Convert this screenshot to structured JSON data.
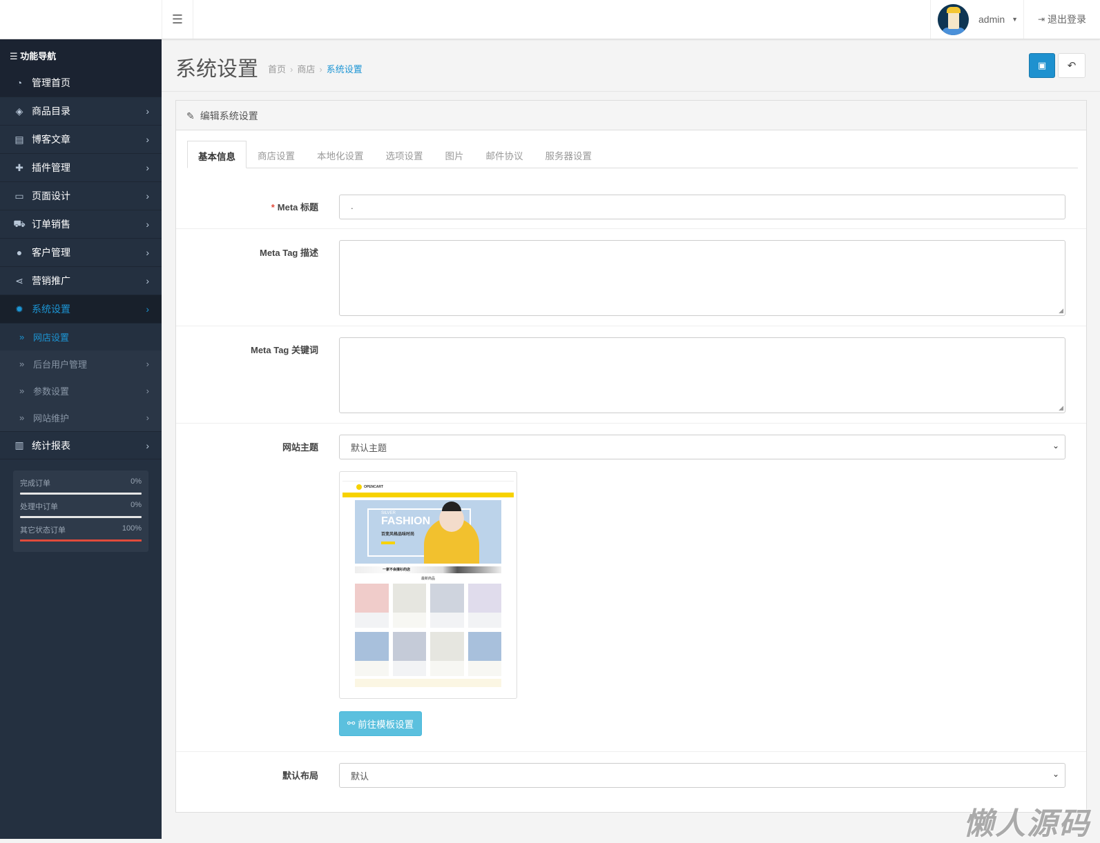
{
  "header": {
    "menu_icon": "bars-icon",
    "user": "admin",
    "logout": "退出登录"
  },
  "sidebar": {
    "title": "功能导航",
    "items": [
      {
        "label": "管理首页",
        "icon": "dashboard-icon"
      },
      {
        "label": "商品目录",
        "icon": "tags-icon"
      },
      {
        "label": "博客文章",
        "icon": "newspaper-icon"
      },
      {
        "label": "插件管理",
        "icon": "puzzle-icon"
      },
      {
        "label": "页面设计",
        "icon": "desktop-icon"
      },
      {
        "label": "订单销售",
        "icon": "cart-icon"
      },
      {
        "label": "客户管理",
        "icon": "user-icon"
      },
      {
        "label": "营销推广",
        "icon": "share-icon"
      },
      {
        "label": "系统设置",
        "icon": "gear-icon"
      }
    ],
    "subitems": [
      {
        "label": "网店设置"
      },
      {
        "label": "后台用户管理"
      },
      {
        "label": "参数设置"
      },
      {
        "label": "网站维护"
      }
    ],
    "reports": {
      "label": "统计报表",
      "icon": "bar-chart-icon"
    },
    "stats": [
      {
        "label": "完成订单",
        "value": "0%",
        "fraction": 0
      },
      {
        "label": "处理中订单",
        "value": "0%",
        "fraction": 0
      },
      {
        "label": "其它状态订单",
        "value": "100%",
        "fraction": 1
      }
    ]
  },
  "page": {
    "title": "系统设置",
    "breadcrumb": [
      "首页",
      "商店",
      "系统设置"
    ],
    "panel_title": "编辑系统设置",
    "tabs": [
      "基本信息",
      "商店设置",
      "本地化设置",
      "选项设置",
      "图片",
      "邮件协议",
      "服务器设置"
    ],
    "form": {
      "meta_title_label": "Meta 标题",
      "meta_title_value": ".",
      "meta_desc_label": "Meta Tag 描述",
      "meta_desc_value": "",
      "meta_kw_label": "Meta Tag 关键词",
      "meta_kw_value": "",
      "theme_label": "网站主题",
      "theme_value": "默认主题",
      "template_button": "前往模板设置",
      "layout_label": "默认布局",
      "layout_value": "默认"
    },
    "preview": {
      "logo": "OPENCART",
      "banner_small": "SILVER",
      "banner_big": "FASHION",
      "banner_cn": "百变风格品味时尚",
      "strip": "一家不会撞衫的店",
      "section": "最新商品"
    }
  },
  "watermark": "懒人源码",
  "colors": {
    "accent": "#1e91cf",
    "sidebar": "#243040",
    "info": "#5bc0de",
    "danger": "#e24b3b"
  }
}
